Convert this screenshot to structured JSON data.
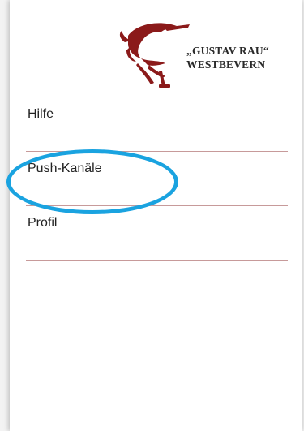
{
  "logo": {
    "line1": "„GUSTAV RAU“",
    "line2": "WESTBEVERN",
    "mark_icon": "horse-jump-icon",
    "mark_color": "#8b1a1a"
  },
  "menu": {
    "items": [
      {
        "label": "Hilfe"
      },
      {
        "label": "Push-Kanäle"
      },
      {
        "label": "Profil"
      }
    ],
    "divider_color": "#c79a9a"
  },
  "annotation": {
    "highlight_color": "#1aa3e0",
    "highlighted_item": "Push-Kanäle"
  }
}
